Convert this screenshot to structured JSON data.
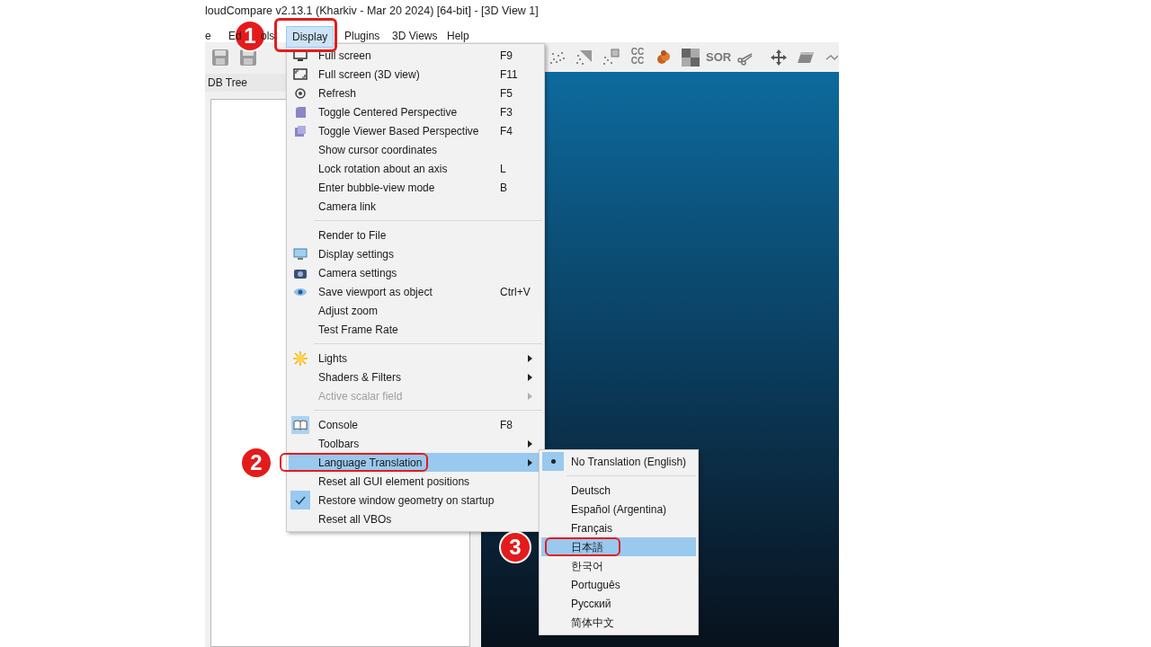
{
  "window": {
    "title": "loudCompare v2.13.1 (Kharkiv - Mar 20 2024) [64-bit] - [3D View 1]"
  },
  "menu_bar": [
    {
      "label": "e",
      "selected": false
    },
    {
      "label": "Ed",
      "selected": false
    },
    {
      "label": "ols",
      "selected": false
    },
    {
      "label": "Display",
      "selected": true
    },
    {
      "label": "Plugins",
      "selected": false
    },
    {
      "label": "3D Views",
      "selected": false
    },
    {
      "label": "Help",
      "selected": false
    }
  ],
  "toolbar": {
    "text_icons": [
      {
        "lines": [
          "CC",
          "CC"
        ]
      },
      {
        "lines": [
          "SOR"
        ]
      }
    ]
  },
  "db_tree": {
    "title": "DB Tree"
  },
  "display_menu": [
    {
      "kind": "item",
      "label": "Full screen",
      "shortcut": "F9",
      "submenu": false,
      "disabled": false,
      "selected": false,
      "checked": false
    },
    {
      "kind": "item",
      "label": "Full screen (3D view)",
      "shortcut": "F11",
      "submenu": false,
      "disabled": false,
      "selected": false,
      "checked": false
    },
    {
      "kind": "item",
      "label": "Refresh",
      "shortcut": "F5",
      "submenu": false,
      "disabled": false,
      "selected": false,
      "checked": false
    },
    {
      "kind": "item",
      "label": "Toggle Centered Perspective",
      "shortcut": "F3",
      "submenu": false,
      "disabled": false,
      "selected": false,
      "checked": false
    },
    {
      "kind": "item",
      "label": "Toggle Viewer Based Perspective",
      "shortcut": "F4",
      "submenu": false,
      "disabled": false,
      "selected": false,
      "checked": false
    },
    {
      "kind": "item",
      "label": "Show cursor coordinates",
      "submenu": false,
      "disabled": false,
      "selected": false,
      "checked": false
    },
    {
      "kind": "item",
      "label": "Lock rotation about an axis",
      "shortcut": "L",
      "submenu": false,
      "disabled": false,
      "selected": false,
      "checked": false
    },
    {
      "kind": "item",
      "label": "Enter bubble-view mode",
      "shortcut": "B",
      "submenu": false,
      "disabled": false,
      "selected": false,
      "checked": false
    },
    {
      "kind": "item",
      "label": "Camera link",
      "submenu": false,
      "disabled": false,
      "selected": false,
      "checked": false
    },
    {
      "kind": "separator"
    },
    {
      "kind": "item",
      "label": "Render to File",
      "submenu": false,
      "disabled": false,
      "selected": false,
      "checked": false
    },
    {
      "kind": "item",
      "label": "Display settings",
      "submenu": false,
      "disabled": false,
      "selected": false,
      "checked": false
    },
    {
      "kind": "item",
      "label": "Camera settings",
      "submenu": false,
      "disabled": false,
      "selected": false,
      "checked": false
    },
    {
      "kind": "item",
      "label": "Save viewport as object",
      "shortcut": "Ctrl+V",
      "submenu": false,
      "disabled": false,
      "selected": false,
      "checked": false
    },
    {
      "kind": "item",
      "label": "Adjust zoom",
      "submenu": false,
      "disabled": false,
      "selected": false,
      "checked": false
    },
    {
      "kind": "item",
      "label": "Test Frame Rate",
      "submenu": false,
      "disabled": false,
      "selected": false,
      "checked": false
    },
    {
      "kind": "separator"
    },
    {
      "kind": "item",
      "label": "Lights",
      "submenu": true,
      "disabled": false,
      "selected": false,
      "checked": false
    },
    {
      "kind": "item",
      "label": "Shaders & Filters",
      "submenu": true,
      "disabled": false,
      "selected": false,
      "checked": false
    },
    {
      "kind": "item",
      "label": "Active scalar field",
      "submenu": true,
      "disabled": true,
      "selected": false,
      "checked": false
    },
    {
      "kind": "separator"
    },
    {
      "kind": "item",
      "label": "Console",
      "shortcut": "F8",
      "submenu": false,
      "disabled": false,
      "selected": false,
      "checked": false
    },
    {
      "kind": "item",
      "label": "Toolbars",
      "submenu": true,
      "disabled": false,
      "selected": false,
      "checked": false
    },
    {
      "kind": "item",
      "label": "Language Translation",
      "submenu": true,
      "disabled": false,
      "selected": true,
      "checked": false
    },
    {
      "kind": "item",
      "label": "Reset all GUI element positions",
      "submenu": false,
      "disabled": false,
      "selected": false,
      "checked": false
    },
    {
      "kind": "item",
      "label": "Restore window geometry on startup",
      "submenu": false,
      "disabled": false,
      "selected": false,
      "checked": true
    },
    {
      "kind": "item",
      "label": "Reset all VBOs",
      "submenu": false,
      "disabled": false,
      "selected": false,
      "checked": false
    }
  ],
  "language_menu": [
    {
      "kind": "item",
      "label": "No Translation (English)",
      "selected": false,
      "checked": true
    },
    {
      "kind": "separator"
    },
    {
      "kind": "item",
      "label": "Deutsch",
      "selected": false,
      "checked": false
    },
    {
      "kind": "item",
      "label": "Español (Argentina)",
      "selected": false,
      "checked": false
    },
    {
      "kind": "item",
      "label": "Français",
      "selected": false,
      "checked": false
    },
    {
      "kind": "item",
      "label": "日本語",
      "selected": true,
      "checked": false
    },
    {
      "kind": "item",
      "label": "한국어",
      "selected": false,
      "checked": false
    },
    {
      "kind": "item",
      "label": "Português",
      "selected": false,
      "checked": false
    },
    {
      "kind": "item",
      "label": "Русский",
      "selected": false,
      "checked": false
    },
    {
      "kind": "item",
      "label": "简体中文",
      "selected": false,
      "checked": false
    }
  ],
  "annotations": [
    {
      "label": "1"
    },
    {
      "label": "2"
    },
    {
      "label": "3"
    }
  ]
}
